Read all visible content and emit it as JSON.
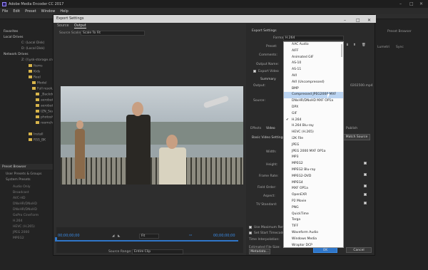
{
  "app": {
    "title": "Adobe Media Encoder CC 2017"
  },
  "menu": [
    "File",
    "Edit",
    "Preset",
    "Window",
    "Help"
  ],
  "left_panel": {
    "favorites": "Favorites",
    "local_drives": "Local Drives",
    "drive_c": "C: (Local Disk)",
    "drive_d": "D: (Local Disk)",
    "network_drives": "Network Drives",
    "network_item": "Z: (\\\\ysk-storage.cn",
    "folders": [
      "Items",
      "Kids",
      "Reel",
      "Model",
      "Full resolution",
      "_Backdrop",
      "aerobatics",
      "aerobatics",
      "IZN_Search",
      "photoshop",
      "roomchanx"
    ],
    "install": "Install",
    "rss": "RSS_BK",
    "preset_browser": "Preset Browser",
    "user_presets": "User Presets & Groups",
    "system_presets": "System Presets",
    "presets": [
      "Audio Only",
      "Broadcast",
      "AVC-HD",
      "DNxHR/DNxHD",
      "DNxHR/DNxHD",
      "GoPro CineForm",
      "H.264",
      "HEVC (H.265)",
      "JPEG 2000",
      "MPEG2"
    ]
  },
  "dialog": {
    "title": "Export Settings",
    "tabs": [
      "Source",
      "Output"
    ],
    "source_scaling_label": "Source Scaling:",
    "source_scaling_value": "Scale To Fit",
    "timecode_start": "00;00;00;00",
    "timecode_end": "00;00;00;00",
    "fit": "Fit",
    "source_range_label": "Source Range:",
    "source_range_value": "Entire Clip",
    "export_settings_header": "Export Settings",
    "format_label": "Format:",
    "format_value": "H.264",
    "preset_label": "Preset:",
    "comments_label": "Comments:",
    "output_name_label": "Output Name:",
    "export_video": "Export Video",
    "summary": "Summary",
    "output": "Output:",
    "source": "Source:",
    "effects_tab": "Effects",
    "video_tab": "Video",
    "basic_video": "Basic Video Settings",
    "match_source": "Match Source",
    "width_label": "Width:",
    "height_label": "Height:",
    "frame_rate_label": "Frame Rate:",
    "field_order_label": "Field Order:",
    "aspect_label": "Aspect:",
    "tv_standard_label": "TV Standard:",
    "use_max_render": "Use Maximum Render Quality",
    "set_start_timecode": "Set Start Timecode",
    "time_interpolation": "Time Interpolation:",
    "estimated_file_size": "Estimated File Size:",
    "metadata_btn": "Metadata...",
    "ok": "OK",
    "cancel": "Cancel",
    "publish": "Publish",
    "filename_frag": "0202500.mp4"
  },
  "format_list": {
    "selected": "H.264",
    "highlighted": "Compressed JPEG2000 MXF",
    "items": [
      "AAC Audio",
      "AIFF",
      "Animated GIF",
      "AS-10",
      "AS-11",
      "AVI",
      "AVI (Uncompressed)",
      "BMP",
      "Compressed JPEG2000 MXF",
      "DNxHR/DNxHD MXF OP1a",
      "DPX",
      "GIF",
      "H.264",
      "H.264 Blu-ray",
      "HEVC (H.265)",
      "i2K File",
      "JPEG",
      "JPEG 2000 MXF OP1a",
      "MP3",
      "MPEG2",
      "MPEG2 Blu-ray",
      "MPEG2-DVD",
      "MPEG4",
      "MXF OP1a",
      "OpenEXR",
      "P2 Movie",
      "PNG",
      "QuickTime",
      "Targa",
      "TIFF",
      "Waveform Audio",
      "Windows Media",
      "Wraptor DCP"
    ]
  },
  "right_panel": {
    "header": "Preset Browser",
    "tabs": [
      "Lumetri",
      "Sync"
    ]
  }
}
